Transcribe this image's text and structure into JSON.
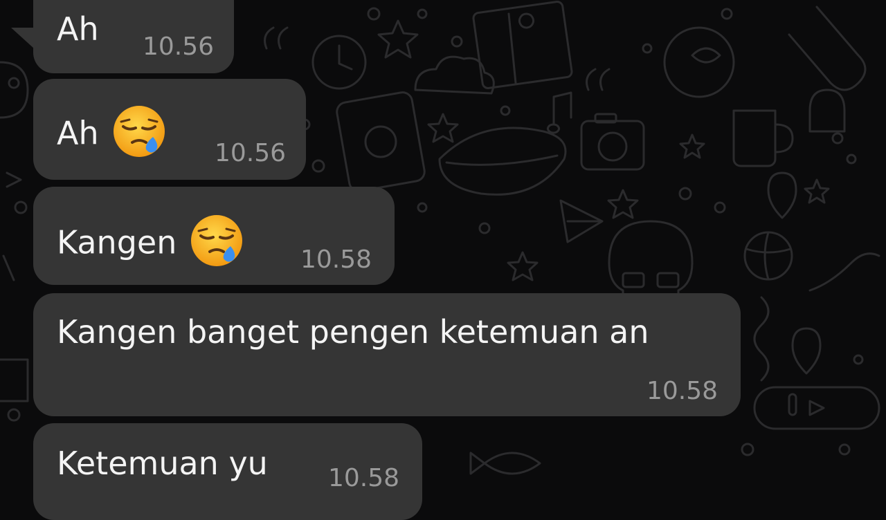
{
  "theme": {
    "background": "#0b0b0c",
    "bubble": "#353535",
    "text": "#f4f4f4",
    "time": "#9a9a9a"
  },
  "messages": [
    {
      "text": "Ah",
      "time": "10.56",
      "emoji": ""
    },
    {
      "text": "Ah",
      "time": "10.56",
      "emoji": "sleepy-face-emoji"
    },
    {
      "text": "Kangen",
      "time": "10.58",
      "emoji": "sleepy-face-emoji"
    },
    {
      "text": "Kangen banget pengen ketemuan an",
      "time": "10.58",
      "emoji": ""
    },
    {
      "text": "Ketemuan yu",
      "time": "10.58",
      "emoji": ""
    }
  ]
}
